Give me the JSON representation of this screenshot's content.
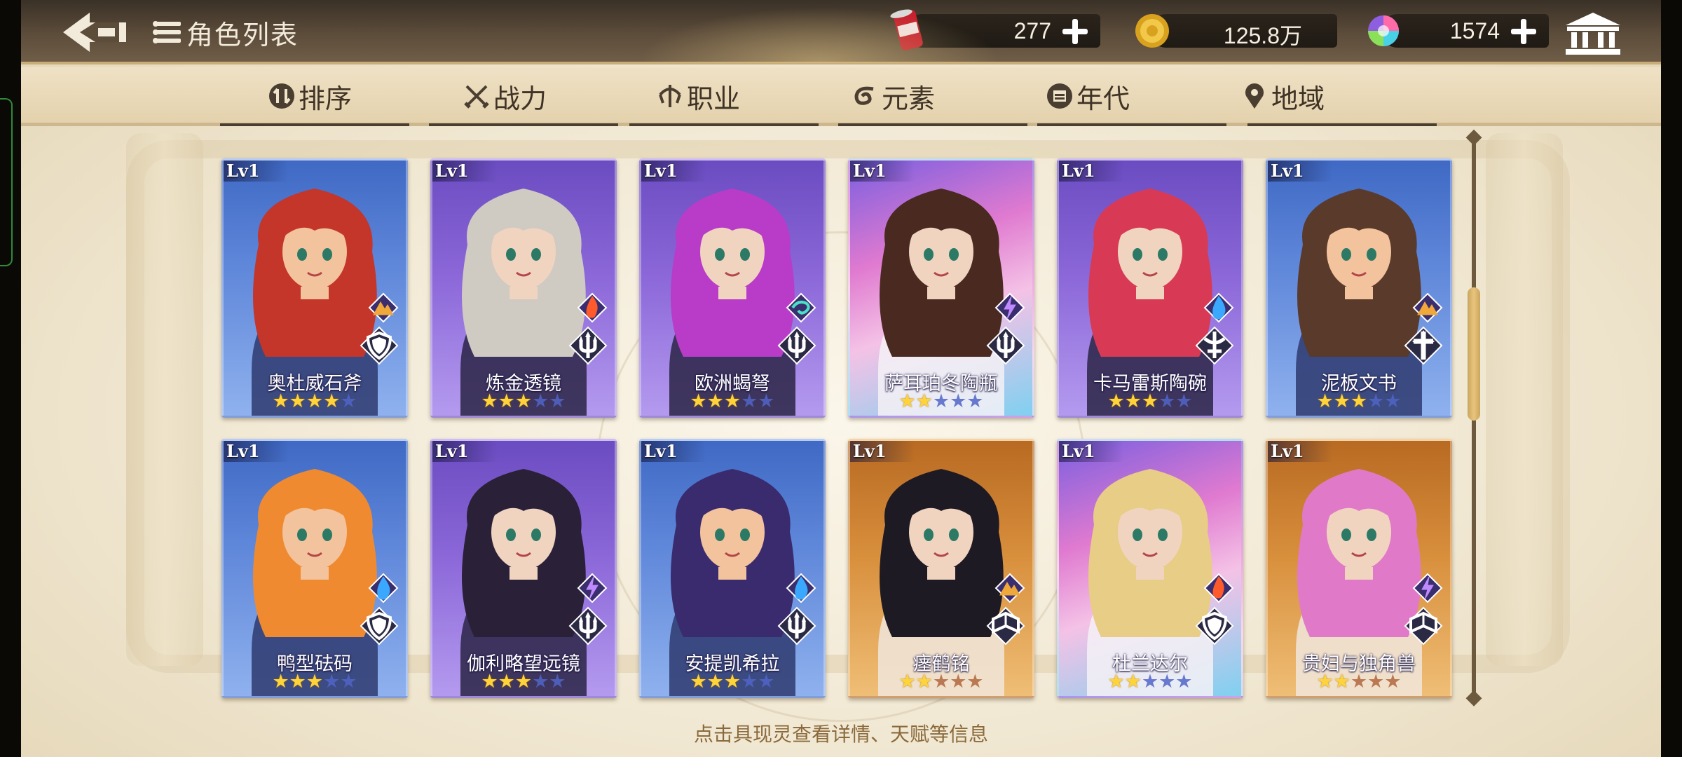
{
  "header": {
    "title": "角色列表",
    "resources": [
      {
        "name": "drink-can",
        "icon": "can-icon",
        "value": "277"
      },
      {
        "name": "gold",
        "icon": "coin-icon",
        "value": "125.8万"
      },
      {
        "name": "gem",
        "icon": "rainbow-gem-icon",
        "value": "1574"
      }
    ]
  },
  "filters": [
    {
      "label": "排序",
      "icon": "sort-icon"
    },
    {
      "label": "战力",
      "icon": "swords-icon"
    },
    {
      "label": "职业",
      "icon": "class-icon"
    },
    {
      "label": "元素",
      "icon": "element-swirl-icon"
    },
    {
      "label": "年代",
      "icon": "calendar-icon"
    },
    {
      "label": "地域",
      "icon": "location-pin-icon"
    }
  ],
  "cards": [
    {
      "lv": "Lv1",
      "name": "奥杜威石斧",
      "stars": 4,
      "max": 5,
      "frame": "blue",
      "element": "earth",
      "cls": "shield"
    },
    {
      "lv": "Lv1",
      "name": "炼金透镜",
      "stars": 3,
      "max": 5,
      "frame": "purple",
      "element": "fire",
      "cls": "trident"
    },
    {
      "lv": "Lv1",
      "name": "欧洲蝎弩",
      "stars": 3,
      "max": 5,
      "frame": "purple",
      "element": "wind",
      "cls": "trident"
    },
    {
      "lv": "Lv1",
      "name": "萨耳珀冬陶瓶",
      "stars": 2,
      "max": 5,
      "frame": "rainbow",
      "element": "thunder",
      "cls": "trident"
    },
    {
      "lv": "Lv1",
      "name": "卡马雷斯陶碗",
      "stars": 3,
      "max": 5,
      "frame": "purple",
      "element": "water",
      "cls": "sword"
    },
    {
      "lv": "Lv1",
      "name": "泥板文书",
      "stars": 3,
      "max": 5,
      "frame": "blue",
      "element": "earth",
      "cls": "cross"
    },
    {
      "lv": "Lv1",
      "name": "鸭型砝码",
      "stars": 3,
      "max": 5,
      "frame": "blue",
      "element": "water",
      "cls": "shield"
    },
    {
      "lv": "Lv1",
      "name": "伽利略望远镜",
      "stars": 3,
      "max": 5,
      "frame": "purple",
      "element": "thunder",
      "cls": "trident"
    },
    {
      "lv": "Lv1",
      "name": "安提凯希拉",
      "stars": 3,
      "max": 5,
      "frame": "blue",
      "element": "water",
      "cls": "trident"
    },
    {
      "lv": "Lv1",
      "name": "瘗鹤铭",
      "stars": 2,
      "max": 5,
      "frame": "gold",
      "element": "earth",
      "cls": "book"
    },
    {
      "lv": "Lv1",
      "name": "杜兰达尔",
      "stars": 2,
      "max": 5,
      "frame": "rainbow",
      "element": "fire",
      "cls": "shield"
    },
    {
      "lv": "Lv1",
      "name": "贵妇与独角兽",
      "stars": 2,
      "max": 5,
      "frame": "gold",
      "element": "thunder",
      "cls": "book"
    }
  ],
  "hint": "点击具现灵查看详情、天赋等信息",
  "colors": {
    "frame_gold": "#c9ad78",
    "text_brown": "#3f3326",
    "hint_brown": "#8a6a3c"
  }
}
